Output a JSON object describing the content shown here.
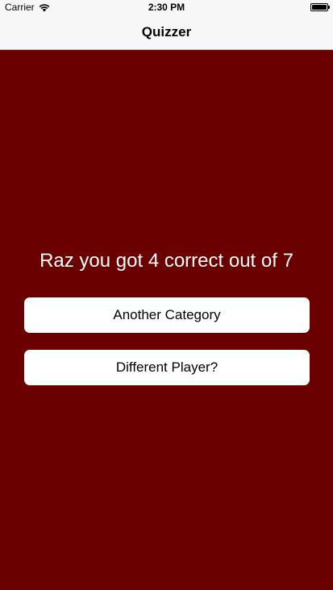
{
  "status_bar": {
    "carrier": "Carrier",
    "time": "2:30 PM",
    "icons": [
      "wifi-icon",
      "battery-icon"
    ]
  },
  "nav": {
    "title": "Quizzer"
  },
  "result": {
    "message": "Raz you got 4 correct out of 7"
  },
  "buttons": {
    "another_category": "Another Category",
    "different_player": "Different Player?"
  },
  "colors": {
    "background": "#6b0000",
    "button": "#ffffff",
    "nav_bar": "#f7f7f7"
  }
}
